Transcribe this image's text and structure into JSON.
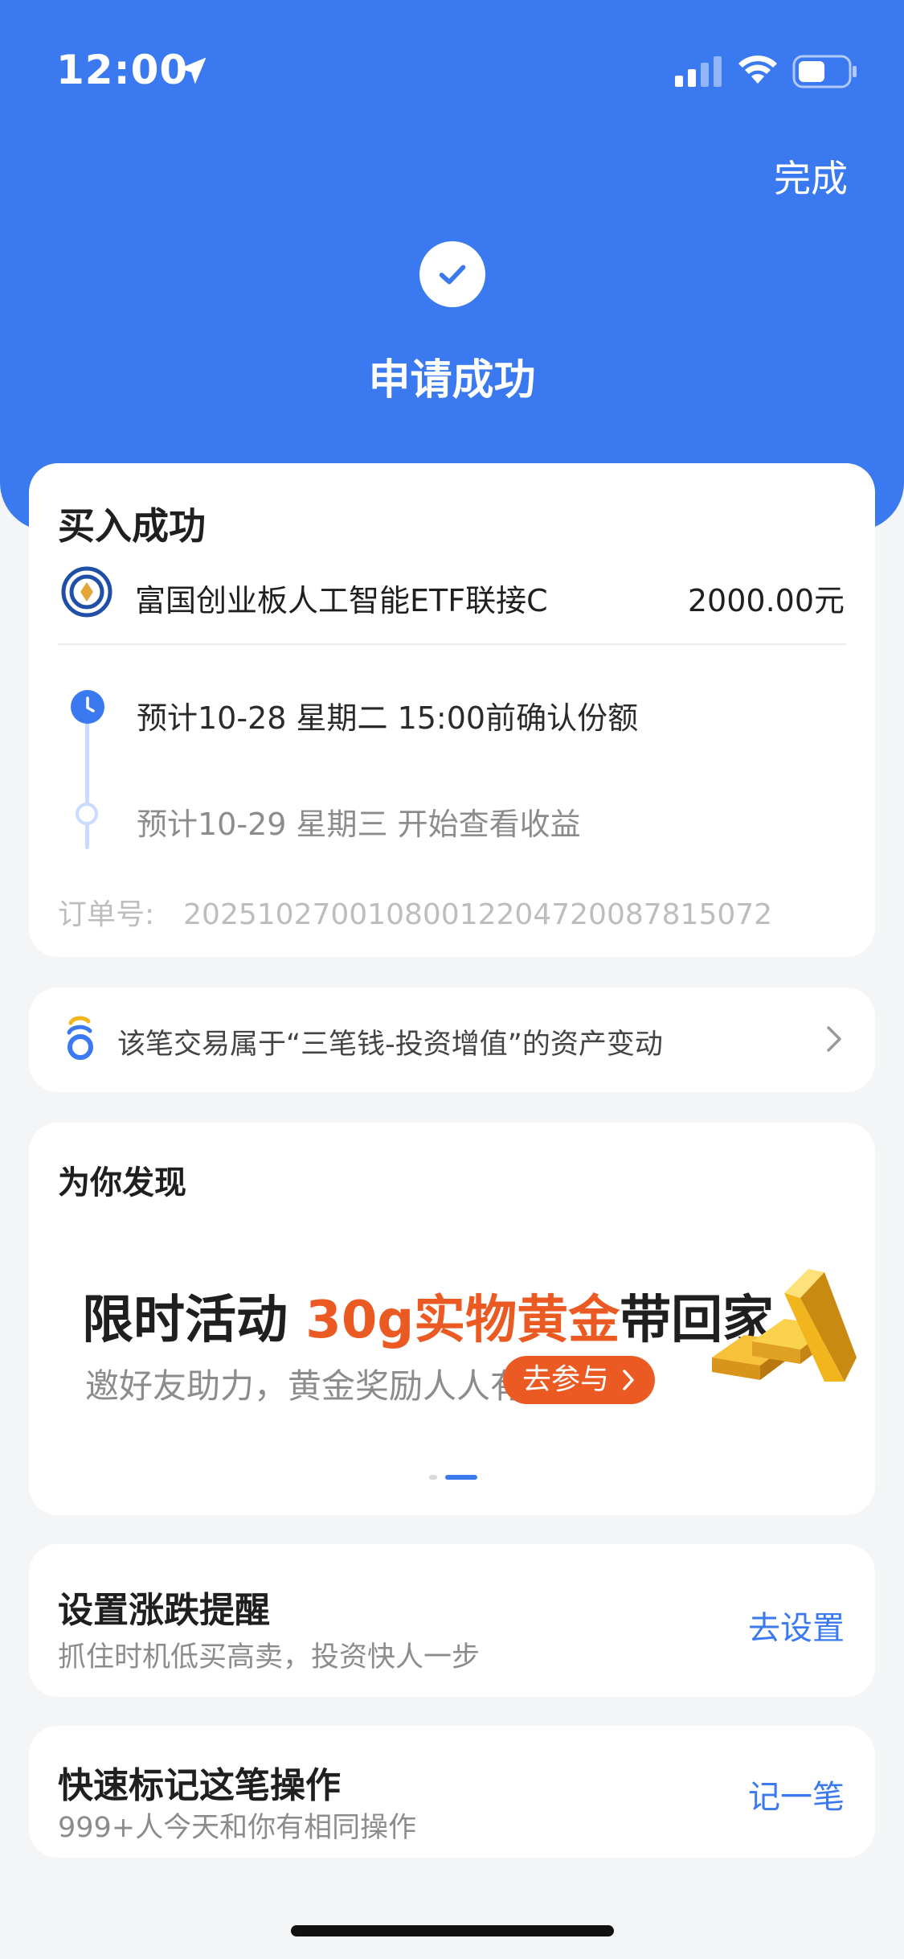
{
  "status_bar": {
    "time": "12:00"
  },
  "header": {
    "done_label": "完成",
    "title": "申请成功",
    "accent_color": "#3a79f0"
  },
  "buy_card": {
    "title": "买入成功",
    "fund_name": "富国创业板人工智能ETF联接C",
    "amount": "2000.00元",
    "steps": [
      {
        "text": "预计10-28 星期二 15:00前确认份额",
        "icon": "clock-icon"
      },
      {
        "text": "预计10-29 星期三 开始查看收益",
        "icon": "hollow-dot"
      }
    ],
    "order_label": "订单号:",
    "order_number": "2025102700108001220472008781507​2"
  },
  "asset_link": {
    "text": "该笔交易属于“三笔钱-投资增值”的资产变动"
  },
  "discover": {
    "title": "为你发现",
    "banner": {
      "headline_prefix": "限时活动 ",
      "headline_highlight": "30g实物黄金",
      "headline_suffix": "带回家",
      "subtitle": "邀好友助力，黄金奖励人人有",
      "button": "去参与",
      "highlight_color": "#ea5a22"
    },
    "carousel_pages": 2,
    "carousel_active": 2
  },
  "price_alert": {
    "title": "设置涨跌提醒",
    "subtitle": "抓住时机低买高卖，投资快人一步",
    "action": "去设置"
  },
  "quick_mark": {
    "title": "快速标记这笔操作",
    "subtitle": "999+人今天和你有相同操作",
    "action": "记一笔"
  }
}
